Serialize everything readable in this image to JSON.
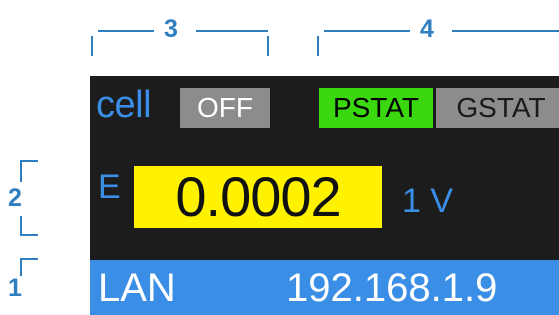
{
  "callouts": {
    "c1": "1",
    "c2": "2",
    "c3": "3",
    "c4": "4"
  },
  "screen": {
    "cell_label": "cell",
    "cell_button": "OFF",
    "mode_pstat": "PSTAT",
    "mode_gstat": "GSTAT",
    "e_label": "E",
    "e_value": "0.0002",
    "e_range": "1 V",
    "lan_label": "LAN",
    "lan_ip": "192.168.1.9"
  },
  "colors": {
    "accent_blue": "#3a8ee6",
    "screen_bg": "#1c1c1c",
    "pstat_active": "#3bd70f",
    "inactive_gray": "#8c8c8c",
    "value_highlight": "#fff200",
    "callout_blue": "#2f7fc0"
  }
}
